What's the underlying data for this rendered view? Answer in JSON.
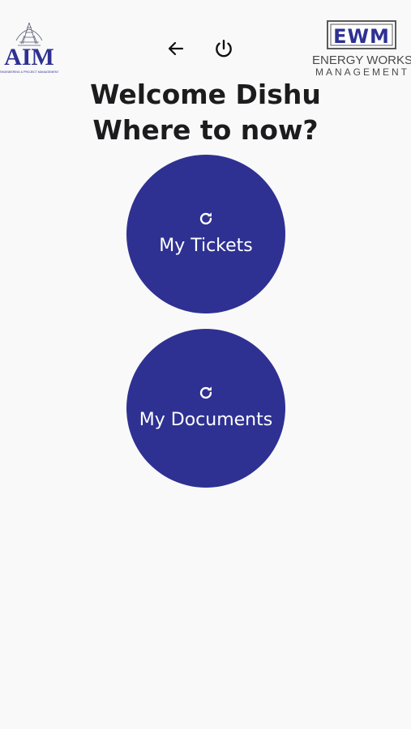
{
  "header": {
    "left_logo": {
      "text": "AIM",
      "tagline": "ENGINEERING & PROJECT MANAGEMENT",
      "color": "#2e3192"
    },
    "right_logo": {
      "mark": "EWM",
      "line1": "ENERGY WORKS",
      "line2": "MANAGEMENT",
      "color": "#4a4a4a"
    },
    "icons": {
      "back": "arrow-left-icon",
      "power": "power-icon"
    }
  },
  "main": {
    "welcome_line": "Welcome Dishu",
    "question_line": "Where to now?",
    "buttons": [
      {
        "label": "My Tickets",
        "icon": "refresh-icon"
      },
      {
        "label": "My Documents",
        "icon": "refresh-icon"
      }
    ]
  },
  "colors": {
    "accent": "#2e3192",
    "background": "#f9f9f9",
    "text": "#1c1c1e"
  }
}
